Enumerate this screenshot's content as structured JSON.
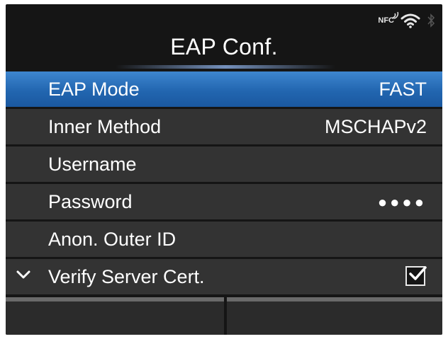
{
  "status": {
    "nfc_label": "NFC"
  },
  "header": {
    "title": "EAP Conf."
  },
  "menu": {
    "items": [
      {
        "label": "EAP Mode",
        "value": "FAST",
        "selected": true
      },
      {
        "label": "Inner Method",
        "value": "MSCHAPv2"
      },
      {
        "label": "Username",
        "value": ""
      },
      {
        "label": "Password",
        "value": "●●●●"
      },
      {
        "label": "Anon. Outer ID",
        "value": ""
      },
      {
        "label": "Verify Server Cert.",
        "checked": true
      }
    ]
  },
  "colors": {
    "background": "#151515",
    "row": "#333333",
    "selected": "#2a72bd",
    "text": "#ffffff"
  },
  "icons": [
    "nfc-icon",
    "wifi-icon",
    "bluetooth-icon",
    "chevron-down-icon",
    "checkbox-icon"
  ]
}
